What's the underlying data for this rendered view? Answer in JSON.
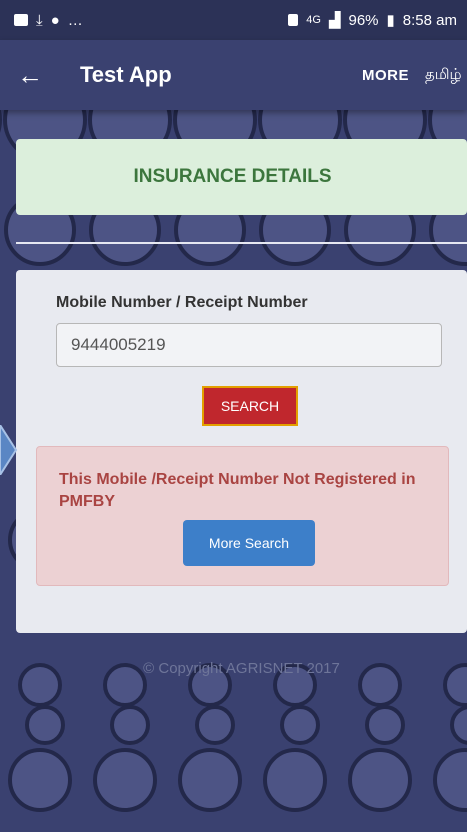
{
  "status_bar": {
    "left_indicators": "…",
    "signal_text": "4G",
    "battery": "96%",
    "time": "8:58 am"
  },
  "app_bar": {
    "title": "Test App",
    "more_label": "MORE",
    "language_label": "தமிழ்"
  },
  "insurance": {
    "title": "INSURANCE DETAILS"
  },
  "search": {
    "label": "Mobile Number / Receipt Number",
    "input_value": "9444005219",
    "button_label": "SEARCH"
  },
  "alert": {
    "message": "This Mobile /Receipt Number Not Registered in PMFBY",
    "more_search_label": "More Search"
  },
  "footer": {
    "copyright": "© Copyright AGRISNET 2017"
  },
  "colors": {
    "background": "#3a4170",
    "success_bg": "#dcefdc",
    "success_text": "#3c763d",
    "danger_bg": "#ecd1d3",
    "danger_text": "#a94442",
    "search_button": "#c0272d",
    "primary_button": "#3d7fc9"
  }
}
